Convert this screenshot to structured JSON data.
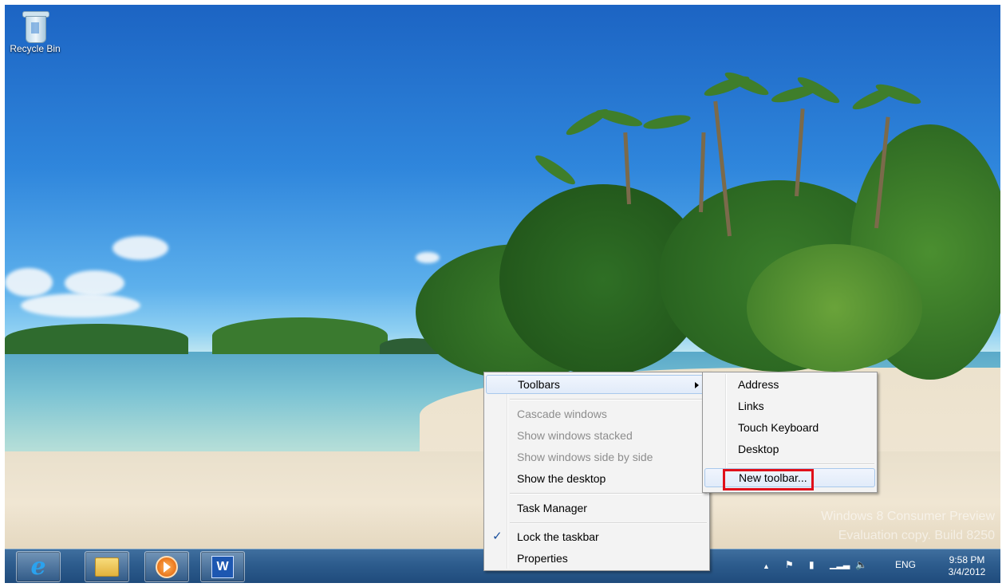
{
  "desktop": {
    "icons": [
      {
        "label": "Recycle Bin",
        "icon": "recycle-bin-icon"
      }
    ],
    "watermark": {
      "line1": "Windows 8 Consumer Preview",
      "line2": "Evaluation copy. Build 8250"
    }
  },
  "taskbar": {
    "pinned": [
      {
        "name": "Internet Explorer",
        "icon": "internet-explorer-icon"
      },
      {
        "name": "File Explorer",
        "icon": "folder-icon"
      },
      {
        "name": "Windows Media Player",
        "icon": "media-player-icon"
      },
      {
        "name": "Microsoft Word",
        "icon": "word-icon",
        "glyph": "W"
      }
    ],
    "tray": {
      "language": "ENG",
      "time": "9:58 PM",
      "date": "3/4/2012",
      "icons": [
        "show-hidden-icons-icon",
        "action-center-flag-icon",
        "power-icon",
        "network-signal-icon",
        "volume-icon"
      ]
    }
  },
  "context_menu": {
    "items": [
      {
        "label": "Toolbars",
        "submenu": true,
        "highlighted": true
      },
      {
        "label": "Cascade windows",
        "disabled": true
      },
      {
        "label": "Show windows stacked",
        "disabled": true
      },
      {
        "label": "Show windows side by side",
        "disabled": true
      },
      {
        "label": "Show the desktop"
      },
      {
        "label": "Task Manager"
      },
      {
        "label": "Lock the taskbar",
        "checked": true
      },
      {
        "label": "Properties"
      }
    ]
  },
  "toolbars_submenu": {
    "items": [
      {
        "label": "Address"
      },
      {
        "label": "Links"
      },
      {
        "label": "Touch Keyboard"
      },
      {
        "label": "Desktop"
      },
      {
        "label": "New toolbar...",
        "highlighted": true,
        "annotated": true
      }
    ]
  },
  "colors": {
    "annotation_box": "#e0101a",
    "taskbar": "#2d5c8d",
    "menu_background": "#f3f3f3",
    "highlight_border": "#a8c8ec"
  }
}
